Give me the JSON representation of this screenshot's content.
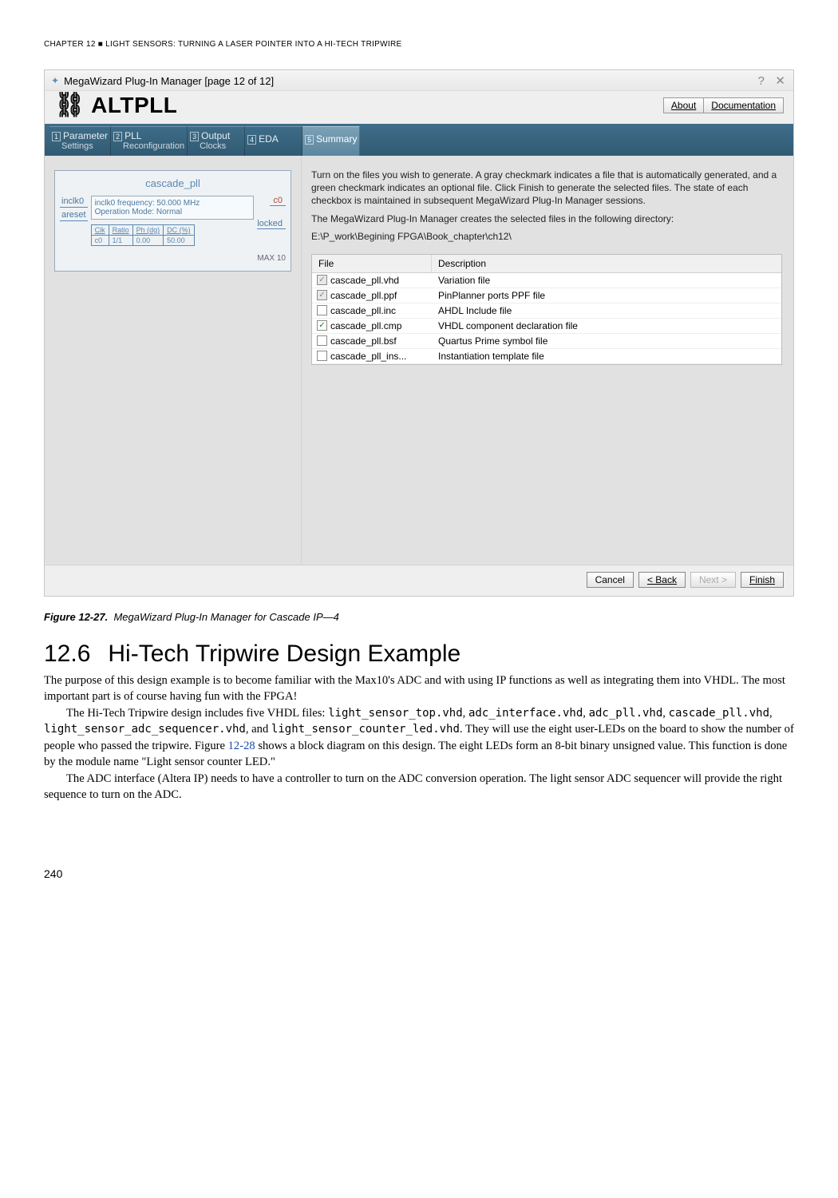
{
  "chapter_header": "CHAPTER 12 ■ LIGHT SENSORS: TURNING A LASER POINTER INTO A HI-TECH TRIPWIRE",
  "window": {
    "title": "MegaWizard Plug-In Manager [page 12 of 12]",
    "product": "ALTPLL",
    "buttons": {
      "about": "About",
      "doc": "Documentation"
    },
    "close_icon": "✕",
    "help_icon": "?"
  },
  "tabs": {
    "t1a": "Parameter",
    "t1b": "Settings",
    "n1": "1",
    "t2a": "PLL",
    "t2b": "Reconfiguration",
    "n2": "2",
    "t3a": "Output",
    "t3b": "Clocks",
    "n3": "3",
    "t4": "EDA",
    "n4": "4",
    "t5": "Summary",
    "n5": "5"
  },
  "diagram": {
    "title": "cascade_pll",
    "in0": "inclk0",
    "in1": "areset",
    "freq": "inclk0 frequency: 50.000 MHz",
    "mode": "Operation Mode: Normal",
    "out": "c0",
    "out2": "locked",
    "th": [
      "Clk",
      "Ratio",
      "Ph (dg)",
      "DC (%)"
    ],
    "tr": [
      "c0",
      "1/1",
      "0.00",
      "50.00"
    ],
    "max": "MAX 10"
  },
  "intro": {
    "p1": "Turn on the files you wish to generate. A gray checkmark indicates a file that is automatically generated, and a green checkmark indicates an optional file. Click Finish to generate the selected files. The state of each checkbox is maintained in subsequent MegaWizard Plug-In Manager sessions.",
    "p2": "The MegaWizard Plug-In Manager creates the selected files in the following directory:",
    "path": "E:\\P_work\\Begining FPGA\\Book_chapter\\ch12\\"
  },
  "file_header": {
    "file": "File",
    "desc": "Description"
  },
  "files": [
    {
      "chk": "gray",
      "name": "cascade_pll.vhd",
      "desc": "Variation file"
    },
    {
      "chk": "gray",
      "name": "cascade_pll.ppf",
      "desc": "PinPlanner ports PPF file"
    },
    {
      "chk": "empty",
      "name": "cascade_pll.inc",
      "desc": "AHDL Include file"
    },
    {
      "chk": "green",
      "name": "cascade_pll.cmp",
      "desc": "VHDL component declaration file"
    },
    {
      "chk": "empty",
      "name": "cascade_pll.bsf",
      "desc": "Quartus Prime symbol file"
    },
    {
      "chk": "empty",
      "name": "cascade_pll_ins...",
      "desc": "Instantiation template file"
    }
  ],
  "footer": {
    "cancel": "Cancel",
    "back": "< Back",
    "next": "Next >",
    "finish": "Finish"
  },
  "figcap": {
    "label": "Figure 12-27.",
    "txt": "MegaWizard Plug-In Manager for Cascade IP—4"
  },
  "section": {
    "num": "12.6",
    "title": "Hi-Tech Tripwire Design Example"
  },
  "body": {
    "p1": "The purpose of this design example is to become familiar with the Max10's ADC and with using IP functions as well as integrating them into VHDL. The most important part is of course having fun with the FPGA!",
    "p2a": "The Hi-Tech Tripwire design includes five VHDL files: ",
    "f1": "light_sensor_top.vhd",
    "c1": ", ",
    "f2": "adc_interface.vhd",
    "c2": ", ",
    "f3": "adc_pll.vhd",
    "c3": ", ",
    "f4": "cascade_pll.vhd",
    "c4": ", ",
    "f5": "light_sensor_adc_sequencer.vhd",
    "c5": ", and ",
    "f6": "light_sensor_counter_led.vhd",
    "p2b": ". They will use the eight user-LEDs on the board to show the number of people who passed the tripwire. Figure ",
    "figref": "12-28",
    "p2c": " shows a block diagram on this design. The eight LEDs form an 8-bit binary unsigned value. This function is done by the module name \"Light sensor counter LED.\"",
    "p3": "The ADC interface (Altera IP) needs to have a controller to turn on the ADC conversion operation. The light sensor ADC sequencer will provide the right sequence to turn on the ADC."
  },
  "page_num": "240"
}
